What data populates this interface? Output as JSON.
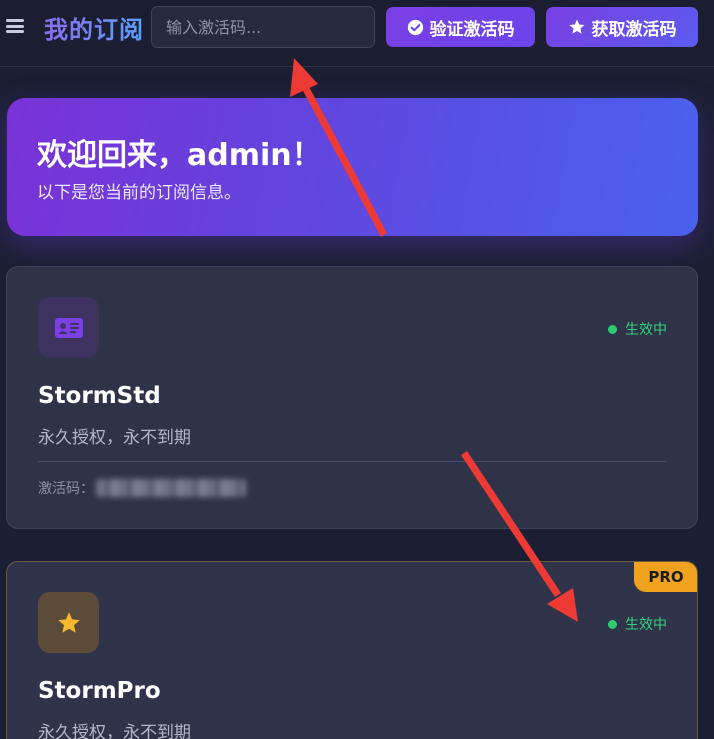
{
  "header": {
    "menu_icon": "menu-icon",
    "title": "我的订阅",
    "code_input": {
      "value": "",
      "placeholder": "输入激活码..."
    },
    "verify_button": {
      "icon": "check-circle-icon",
      "label": "验证激活码"
    },
    "get_button": {
      "icon": "star-icon",
      "label": "获取激活码"
    }
  },
  "welcome": {
    "title": "欢迎回来，admin！",
    "subtitle": "以下是您当前的订阅信息。"
  },
  "subscriptions": [
    {
      "icon": "id-card-icon",
      "name": "StormStd",
      "status": "生效中",
      "description": "永久授权，永不到期",
      "code_label": "激活码："
    },
    {
      "icon": "star-icon",
      "badge": "PRO",
      "name": "StormPro",
      "status": "生效中",
      "description": "永久授权，永不到期"
    }
  ],
  "colors": {
    "accent_purple": "#7b3fe4",
    "accent_blue": "#4a62ee",
    "status_green": "#2ecc71",
    "pro_badge": "#f0a21e",
    "annotation_arrow": "#ee3a35"
  }
}
